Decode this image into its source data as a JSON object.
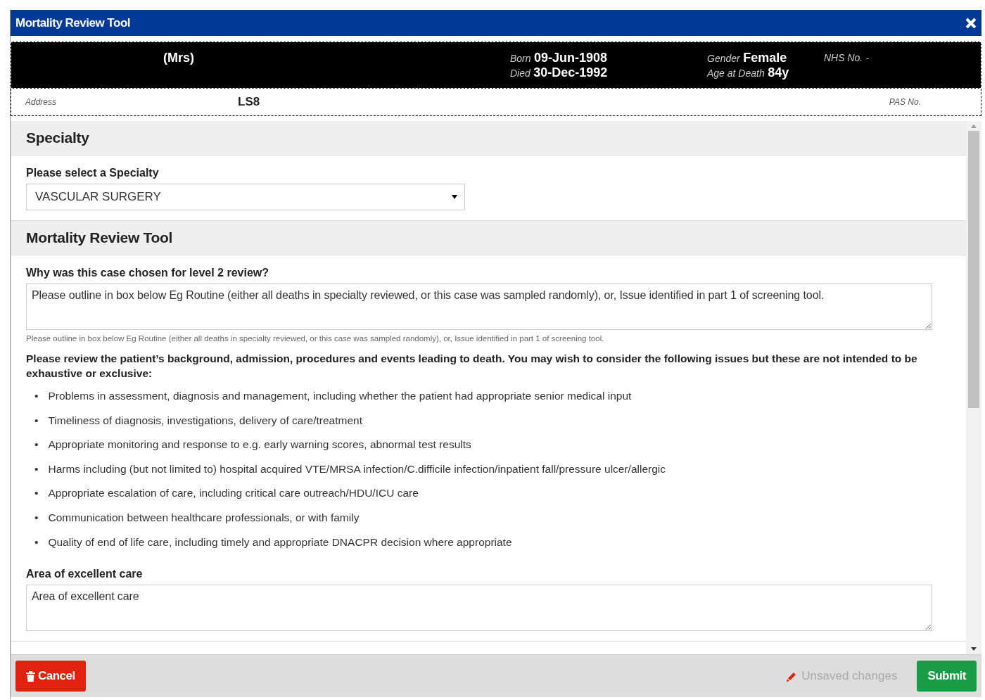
{
  "window": {
    "title": "Mortality Review Tool"
  },
  "patient": {
    "name": "(Mrs)",
    "born_label": "Born",
    "born": "09-Jun-1908",
    "died_label": "Died",
    "died": "30-Dec-1992",
    "gender_label": "Gender",
    "gender": "Female",
    "age_label": "Age at Death",
    "age": "84y",
    "nhs_label": "NHS No.",
    "nhs": "-",
    "address_label": "Address",
    "address": "LS8",
    "pas_label": "PAS No."
  },
  "specialty": {
    "heading": "Specialty",
    "label": "Please select a Specialty",
    "value": "VASCULAR SURGERY"
  },
  "review": {
    "heading": "Mortality Review Tool",
    "question": "Why was this case chosen for level 2 review?",
    "answer": "Please outline in box below Eg Routine (either all deaths in specialty reviewed, or this case was sampled randomly), or, Issue identified in part 1 of screening tool.",
    "help": "Please outline in box below Eg Routine (either all deaths in specialty reviewed, or this case was sampled randomly), or, Issue identified in part 1 of screening tool.",
    "instructions": "Please review the patient’s background, admission, procedures and events leading to death. You may wish to consider the following issues but these are not intended to be exhaustive or exclusive:",
    "issues": [
      {
        "bullet": "•",
        "text": "Problems in assessment, diagnosis and management, including whether the patient had appropriate senior medical input"
      },
      {
        "bullet": "•",
        "text": "Timeliness of diagnosis, investigations, delivery of care/treatment"
      },
      {
        "bullet": "•",
        "text": "Appropriate monitoring and response to e.g. early warning scores, abnormal test results"
      },
      {
        "bullet": "•",
        "text": "Harms including (but not limited to) hospital acquired VTE/MRSA infection/C.difficile infection/inpatient fall/pressure ulcer/allergic"
      },
      {
        "bullet": "•",
        "text": "Appropriate escalation of care, including critical care outreach/HDU/ICU care"
      },
      {
        "bullet": "•",
        "text": "Communication between healthcare professionals, or with family"
      },
      {
        "bullet": "•",
        "text": "Quality of end of life care, including timely and appropriate DNACPR decision where appropriate"
      }
    ],
    "excellent_label": "Area of excellent care",
    "excellent_value": "Area of excellent care"
  },
  "footer": {
    "cancel": "Cancel",
    "status": "Unsaved changes",
    "submit": "Submit"
  }
}
